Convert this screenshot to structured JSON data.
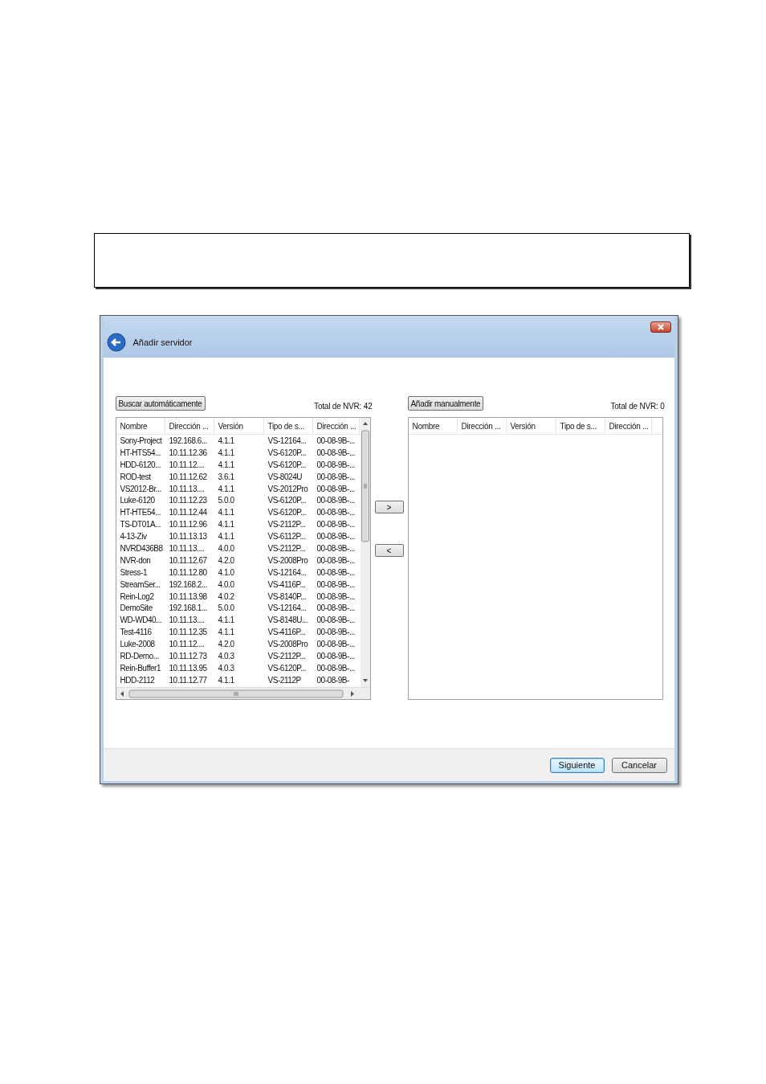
{
  "dialog": {
    "title": "Añadir servidor",
    "left_panel": {
      "button": "Buscar automáticamente",
      "total": "Total de NVR: 42",
      "columns": [
        "Nombre",
        "Dirección ...",
        "Versión",
        "Tipo de s...",
        "Dirección ..."
      ],
      "rows": [
        [
          "Sony-Project",
          "192.168.6...",
          "4.1.1",
          "VS-12164...",
          "00-08-9B-..."
        ],
        [
          "HT-HTS54...",
          "10.11.12.36",
          "4.1.1",
          "VS-6120P...",
          "00-08-9B-..."
        ],
        [
          "HDD-6120...",
          "10.11.12....",
          "4.1.1",
          "VS-6120P...",
          "00-08-9B-..."
        ],
        [
          "ROD-test",
          "10.11.12.62",
          "3.6.1",
          "VS-8024U",
          "00-08-9B-..."
        ],
        [
          "VS2012-Br...",
          "10.11.13....",
          "4.1.1",
          "VS-2012Pro",
          "00-08-9B-..."
        ],
        [
          "Luke-6120",
          "10.11.12.23",
          "5.0.0",
          "VS-6120P...",
          "00-08-9B-..."
        ],
        [
          "HT-HTE54...",
          "10.11.12.44",
          "4.1.1",
          "VS-6120P...",
          "00-08-9B-..."
        ],
        [
          "TS-DT01A...",
          "10.11.12.96",
          "4.1.1",
          "VS-2112P...",
          "00-08-9B-..."
        ],
        [
          "4-13-Ziv",
          "10.11.13.13",
          "4.1.1",
          "VS-6112P...",
          "00-08-9B-..."
        ],
        [
          "NVRD436B8",
          "10.11.13....",
          "4.0.0",
          "VS-2112P...",
          "00-08-9B-..."
        ],
        [
          "NVR-don",
          "10.11.12.67",
          "4.2.0",
          "VS-2008Pro",
          "00-08-9B-..."
        ],
        [
          "Stress-1",
          "10.11.12.80",
          "4.1.0",
          "VS-12164...",
          "00-08-9B-..."
        ],
        [
          "StreamSer...",
          "192.168.2...",
          "4.0.0",
          "VS-4116P...",
          "00-08-9B-..."
        ],
        [
          "Rein-Log2",
          "10.11.13.98",
          "4.0.2",
          "VS-8140P...",
          "00-08-9B-..."
        ],
        [
          "DemoSite",
          "192.168.1...",
          "5.0.0",
          "VS-12164...",
          "00-08-9B-..."
        ],
        [
          "WD-WD40...",
          "10.11.13....",
          "4.1.1",
          "VS-8148U...",
          "00-08-9B-..."
        ],
        [
          "Test-4116",
          "10.11.12.35",
          "4.1.1",
          "VS-4116P...",
          "00-08-9B-..."
        ],
        [
          "Luke-2008",
          "10.11.12....",
          "4.2.0",
          "VS-2008Pro",
          "00-08-9B-..."
        ],
        [
          "RD-Demo...",
          "10.11.12.73",
          "4.0.3",
          "VS-2112P...",
          "00-08-9B-..."
        ],
        [
          "Rein-Buffer1",
          "10.11.13.95",
          "4.0.3",
          "VS-6120P...",
          "00-08-9B-..."
        ],
        [
          "HDD-2112",
          "10.11.12.77",
          "4.1.1",
          "VS-2112P",
          "00-08-9B-"
        ]
      ]
    },
    "move_buttons": [
      ">",
      "<"
    ],
    "right_panel": {
      "button": "Añadir manualmente",
      "total": "Total de NVR: 0",
      "columns": [
        "Nombre",
        "Dirección ...",
        "Versión",
        "Tipo de s...",
        "Dirección ..."
      ]
    },
    "footer_buttons": [
      {
        "label": "Siguiente",
        "default": true
      },
      {
        "label": "Cancelar",
        "default": false
      }
    ]
  }
}
